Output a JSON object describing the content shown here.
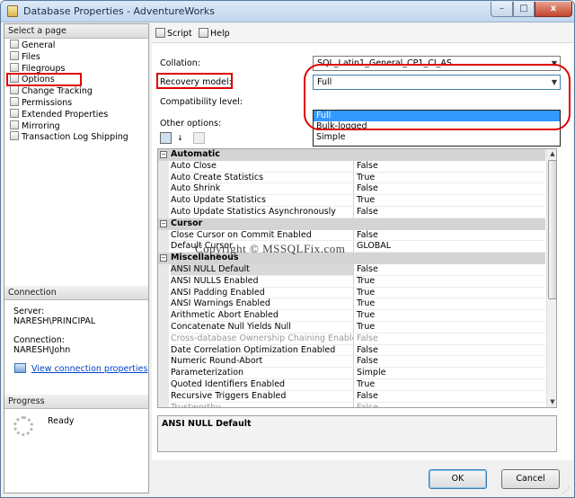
{
  "window": {
    "title": "Database Properties - AdventureWorks",
    "controls": {
      "minimize": "–",
      "maximize": "□",
      "close": "x"
    }
  },
  "left_pane": {
    "select_page_header": "Select a page",
    "pages": [
      {
        "label": "General",
        "icon": "page-icon"
      },
      {
        "label": "Files",
        "icon": "page-icon"
      },
      {
        "label": "Filegroups",
        "icon": "page-icon"
      },
      {
        "label": "Options",
        "icon": "page-icon",
        "selected": true
      },
      {
        "label": "Change Tracking",
        "icon": "page-icon"
      },
      {
        "label": "Permissions",
        "icon": "page-icon"
      },
      {
        "label": "Extended Properties",
        "icon": "page-icon"
      },
      {
        "label": "Mirroring",
        "icon": "page-icon"
      },
      {
        "label": "Transaction Log Shipping",
        "icon": "page-icon"
      }
    ],
    "connection_header": "Connection",
    "server_label": "Server:",
    "server_value": "NARESH\\PRINCIPAL",
    "connection_label": "Connection:",
    "connection_value": "NARESH\\John",
    "view_connection_link": "View connection properties",
    "progress_header": "Progress",
    "progress_status": "Ready"
  },
  "toolbar": {
    "script_label": "Script",
    "help_label": "Help"
  },
  "options": {
    "collation_label": "Collation:",
    "collation_value": "SQL_Latin1_General_CP1_CI_AS",
    "recovery_label": "Recovery model:",
    "recovery_value": "Full",
    "recovery_options": [
      "Full",
      "Bulk-logged",
      "Simple"
    ],
    "compat_label": "Compatibility level:",
    "other_options_label": "Other options:"
  },
  "grid": {
    "rows": [
      {
        "type": "category",
        "name": "Automatic"
      },
      {
        "name": "Auto Close",
        "value": "False"
      },
      {
        "name": "Auto Create Statistics",
        "value": "True"
      },
      {
        "name": "Auto Shrink",
        "value": "False"
      },
      {
        "name": "Auto Update Statistics",
        "value": "True"
      },
      {
        "name": "Auto Update Statistics Asynchronously",
        "value": "False"
      },
      {
        "type": "category",
        "name": "Cursor"
      },
      {
        "name": "Close Cursor on Commit Enabled",
        "value": "False"
      },
      {
        "name": "Default Cursor",
        "value": "GLOBAL"
      },
      {
        "type": "category",
        "name": "Miscellaneous"
      },
      {
        "name": "ANSI NULL Default",
        "value": "False",
        "selected": true
      },
      {
        "name": "ANSI NULLS Enabled",
        "value": "True"
      },
      {
        "name": "ANSI Padding Enabled",
        "value": "True"
      },
      {
        "name": "ANSI Warnings Enabled",
        "value": "True"
      },
      {
        "name": "Arithmetic Abort Enabled",
        "value": "True"
      },
      {
        "name": "Concatenate Null Yields Null",
        "value": "True"
      },
      {
        "name": "Cross-database Ownership Chaining Enabled",
        "value": "False",
        "disabled": true
      },
      {
        "name": "Date Correlation Optimization Enabled",
        "value": "False"
      },
      {
        "name": "Numeric Round-Abort",
        "value": "False"
      },
      {
        "name": "Parameterization",
        "value": "Simple"
      },
      {
        "name": "Quoted Identifiers Enabled",
        "value": "True"
      },
      {
        "name": "Recursive Triggers Enabled",
        "value": "False"
      },
      {
        "name": "Trustworthy",
        "value": "False",
        "disabled": true
      }
    ],
    "description_title": "ANSI NULL Default"
  },
  "watermark": "Copyright ©  MSSQLFix.com",
  "footer": {
    "ok_label": "OK",
    "cancel_label": "Cancel"
  },
  "colors": {
    "annotation": "#e00000",
    "selection": "#3399ff"
  }
}
